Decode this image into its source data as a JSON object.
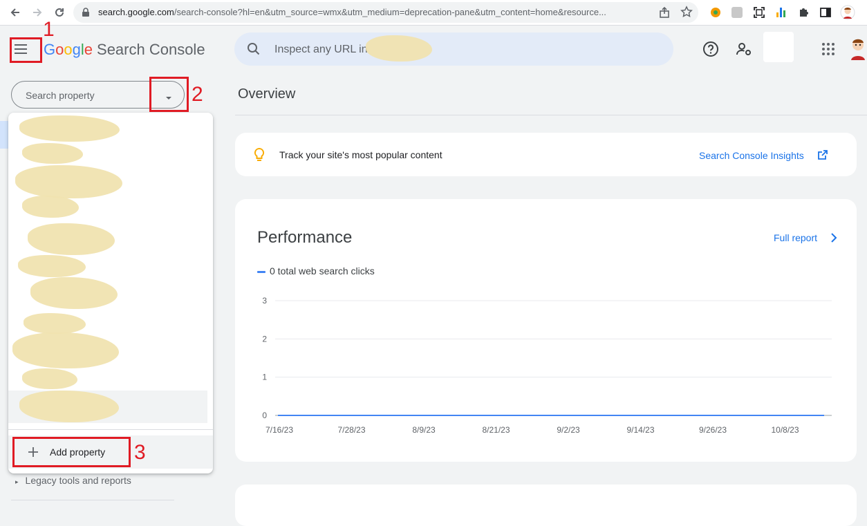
{
  "browser": {
    "url_host": "search.google.com",
    "url_path": "/search-console?hl=en&utm_source=wmx&utm_medium=deprecation-pane&utm_content=home&resource..."
  },
  "header": {
    "brand_google": [
      "G",
      "o",
      "o",
      "g",
      "l",
      "e"
    ],
    "brand_product": "Search Console",
    "inspect_placeholder": "Inspect any URL in"
  },
  "sidebar": {
    "search_placeholder": "Search property",
    "add_property_label": "Add property",
    "legacy_label": "Legacy tools and reports"
  },
  "annotations": {
    "one": "1",
    "two": "2",
    "three": "3"
  },
  "main": {
    "overview_title": "Overview",
    "insights_text": "Track your site's most popular content",
    "insights_link": "Search Console Insights",
    "performance_title": "Performance",
    "full_report_link": "Full report",
    "legend_label": "0 total web search clicks"
  },
  "colors": {
    "accent_blue": "#1a73e8",
    "series_blue": "#4285f4",
    "annotation_red": "#e01b24",
    "bulb_yellow": "#f9ab00"
  },
  "chart_data": {
    "type": "line",
    "x": [
      "7/16/23",
      "7/28/23",
      "8/9/23",
      "8/21/23",
      "9/2/23",
      "9/14/23",
      "9/26/23",
      "10/8/23"
    ],
    "series": [
      {
        "name": "0 total web search clicks",
        "values": [
          0,
          0,
          0,
          0,
          0,
          0,
          0,
          0
        ]
      }
    ],
    "y_ticks": [
      "3",
      "2",
      "1",
      "0"
    ],
    "ylim": [
      0,
      3
    ],
    "grid": true
  }
}
